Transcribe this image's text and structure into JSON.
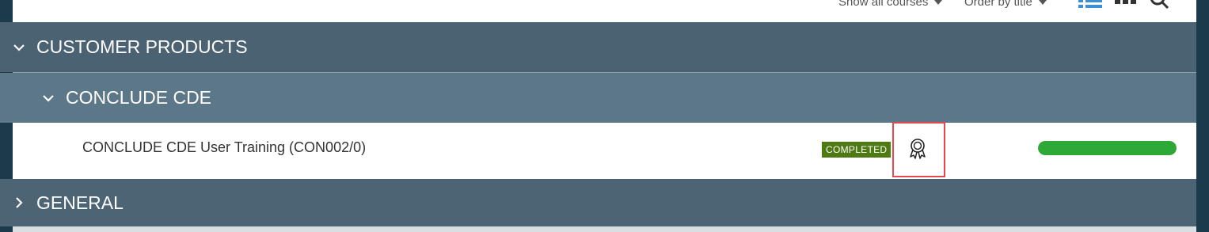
{
  "toolbar": {
    "filter_label": "Show all courses",
    "order_label": "Order by title",
    "list_view_icon": "list-view-icon",
    "grid_view_icon": "grid-view-icon",
    "search_icon": "search-icon"
  },
  "groups": {
    "customer_products": {
      "label": "CUSTOMER PRODUCTS",
      "expanded": true
    },
    "conclude_cde": {
      "label": "CONCLUDE CDE",
      "expanded": true
    },
    "general": {
      "label": "GENERAL",
      "expanded": false
    }
  },
  "course": {
    "title": "CONCLUDE CDE User Training (CON002/0)",
    "status": "COMPLETED",
    "certificate_icon": "certificate-award-icon",
    "progress": 1.0
  },
  "colors": {
    "group_header": "#4a6272",
    "subgroup_header": "#5c7888",
    "completed_badge": "#4e7a12",
    "progress_fill": "#2ea836",
    "highlight": "#e5484d"
  }
}
